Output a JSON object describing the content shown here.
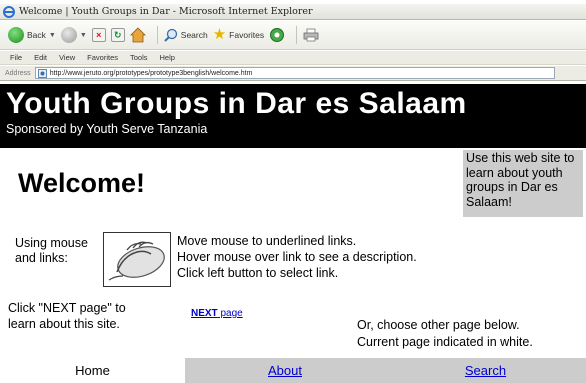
{
  "browser": {
    "window_title": "Welcome | Youth Groups in Dar - Microsoft Internet Explorer",
    "toolbar": {
      "back_label": "Back",
      "search_label": "Search",
      "favorites_label": "Favorites"
    },
    "menu": [
      "File",
      "Edit",
      "View",
      "Favorites",
      "Tools",
      "Help"
    ],
    "address_label": "Address",
    "address_url": "http://www.jeruto.org/prototypes/prototype3benglish/welcome.htm"
  },
  "page": {
    "banner_title": "Youth Groups in Dar es Salaam",
    "banner_subtitle": "Sponsored by Youth Serve Tanzania",
    "welcome": "Welcome!",
    "info_box": "Use this web site to learn about youth groups in Dar es Salaam!",
    "mouse_label_line1": "Using mouse",
    "mouse_label_line2": "and links:",
    "instructions": [
      "Move mouse to underlined links.",
      "Hover mouse over link to see a description.",
      "Click left button to select link."
    ],
    "next_hint_line1": "Click \"NEXT page\" to",
    "next_hint_line2": "learn about this site.",
    "next_link_bold": "NEXT",
    "next_link_rest": " page",
    "choose_line1": "Or, choose other page below.",
    "choose_line2": "Current page indicated in white.",
    "nav": {
      "home": "Home",
      "about": "About",
      "search": "Search"
    }
  },
  "colors": {
    "banner_bg": "#000000",
    "nav_inactive_bg": "#cccccc",
    "nav_active_bg": "#ffffff",
    "link": "#0000cc"
  }
}
